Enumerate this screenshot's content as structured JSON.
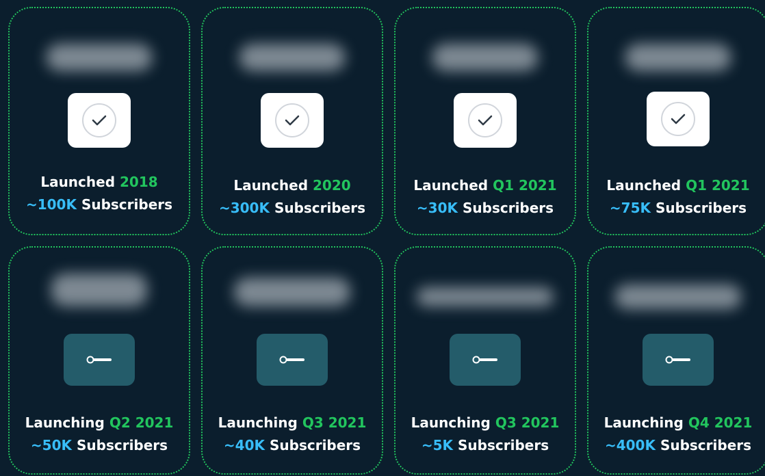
{
  "colors": {
    "background": "#0b1e2d",
    "border": "#22c55e",
    "year_green": "#22c55e",
    "count_blue": "#38bdf8",
    "launched_badge": "#ffffff",
    "launching_badge": "#245c6a"
  },
  "cards": [
    {
      "status": "Launched",
      "date": "2018",
      "count": "~100K",
      "suffix": "Subscribers",
      "icon": "check-icon"
    },
    {
      "status": "Launched",
      "date": "2020",
      "count": "~300K",
      "suffix": "Subscribers",
      "icon": "check-icon"
    },
    {
      "status": "Launched",
      "date": "Q1 2021",
      "count": "~30K",
      "suffix": "Subscribers",
      "icon": "check-icon"
    },
    {
      "status": "Launched",
      "date": "Q1 2021",
      "count": "~75K",
      "suffix": "Subscribers",
      "icon": "check-icon"
    },
    {
      "status": "Launching",
      "date": "Q2 2021",
      "count": "~50K",
      "suffix": "Subscribers",
      "icon": "wrench-icon"
    },
    {
      "status": "Launching",
      "date": "Q3 2021",
      "count": "~40K",
      "suffix": "Subscribers",
      "icon": "wrench-icon"
    },
    {
      "status": "Launching",
      "date": "Q3 2021",
      "count": "~5K",
      "suffix": "Subscribers",
      "icon": "wrench-icon"
    },
    {
      "status": "Launching",
      "date": "Q4 2021",
      "count": "~400K",
      "suffix": "Subscribers",
      "icon": "wrench-icon"
    }
  ]
}
